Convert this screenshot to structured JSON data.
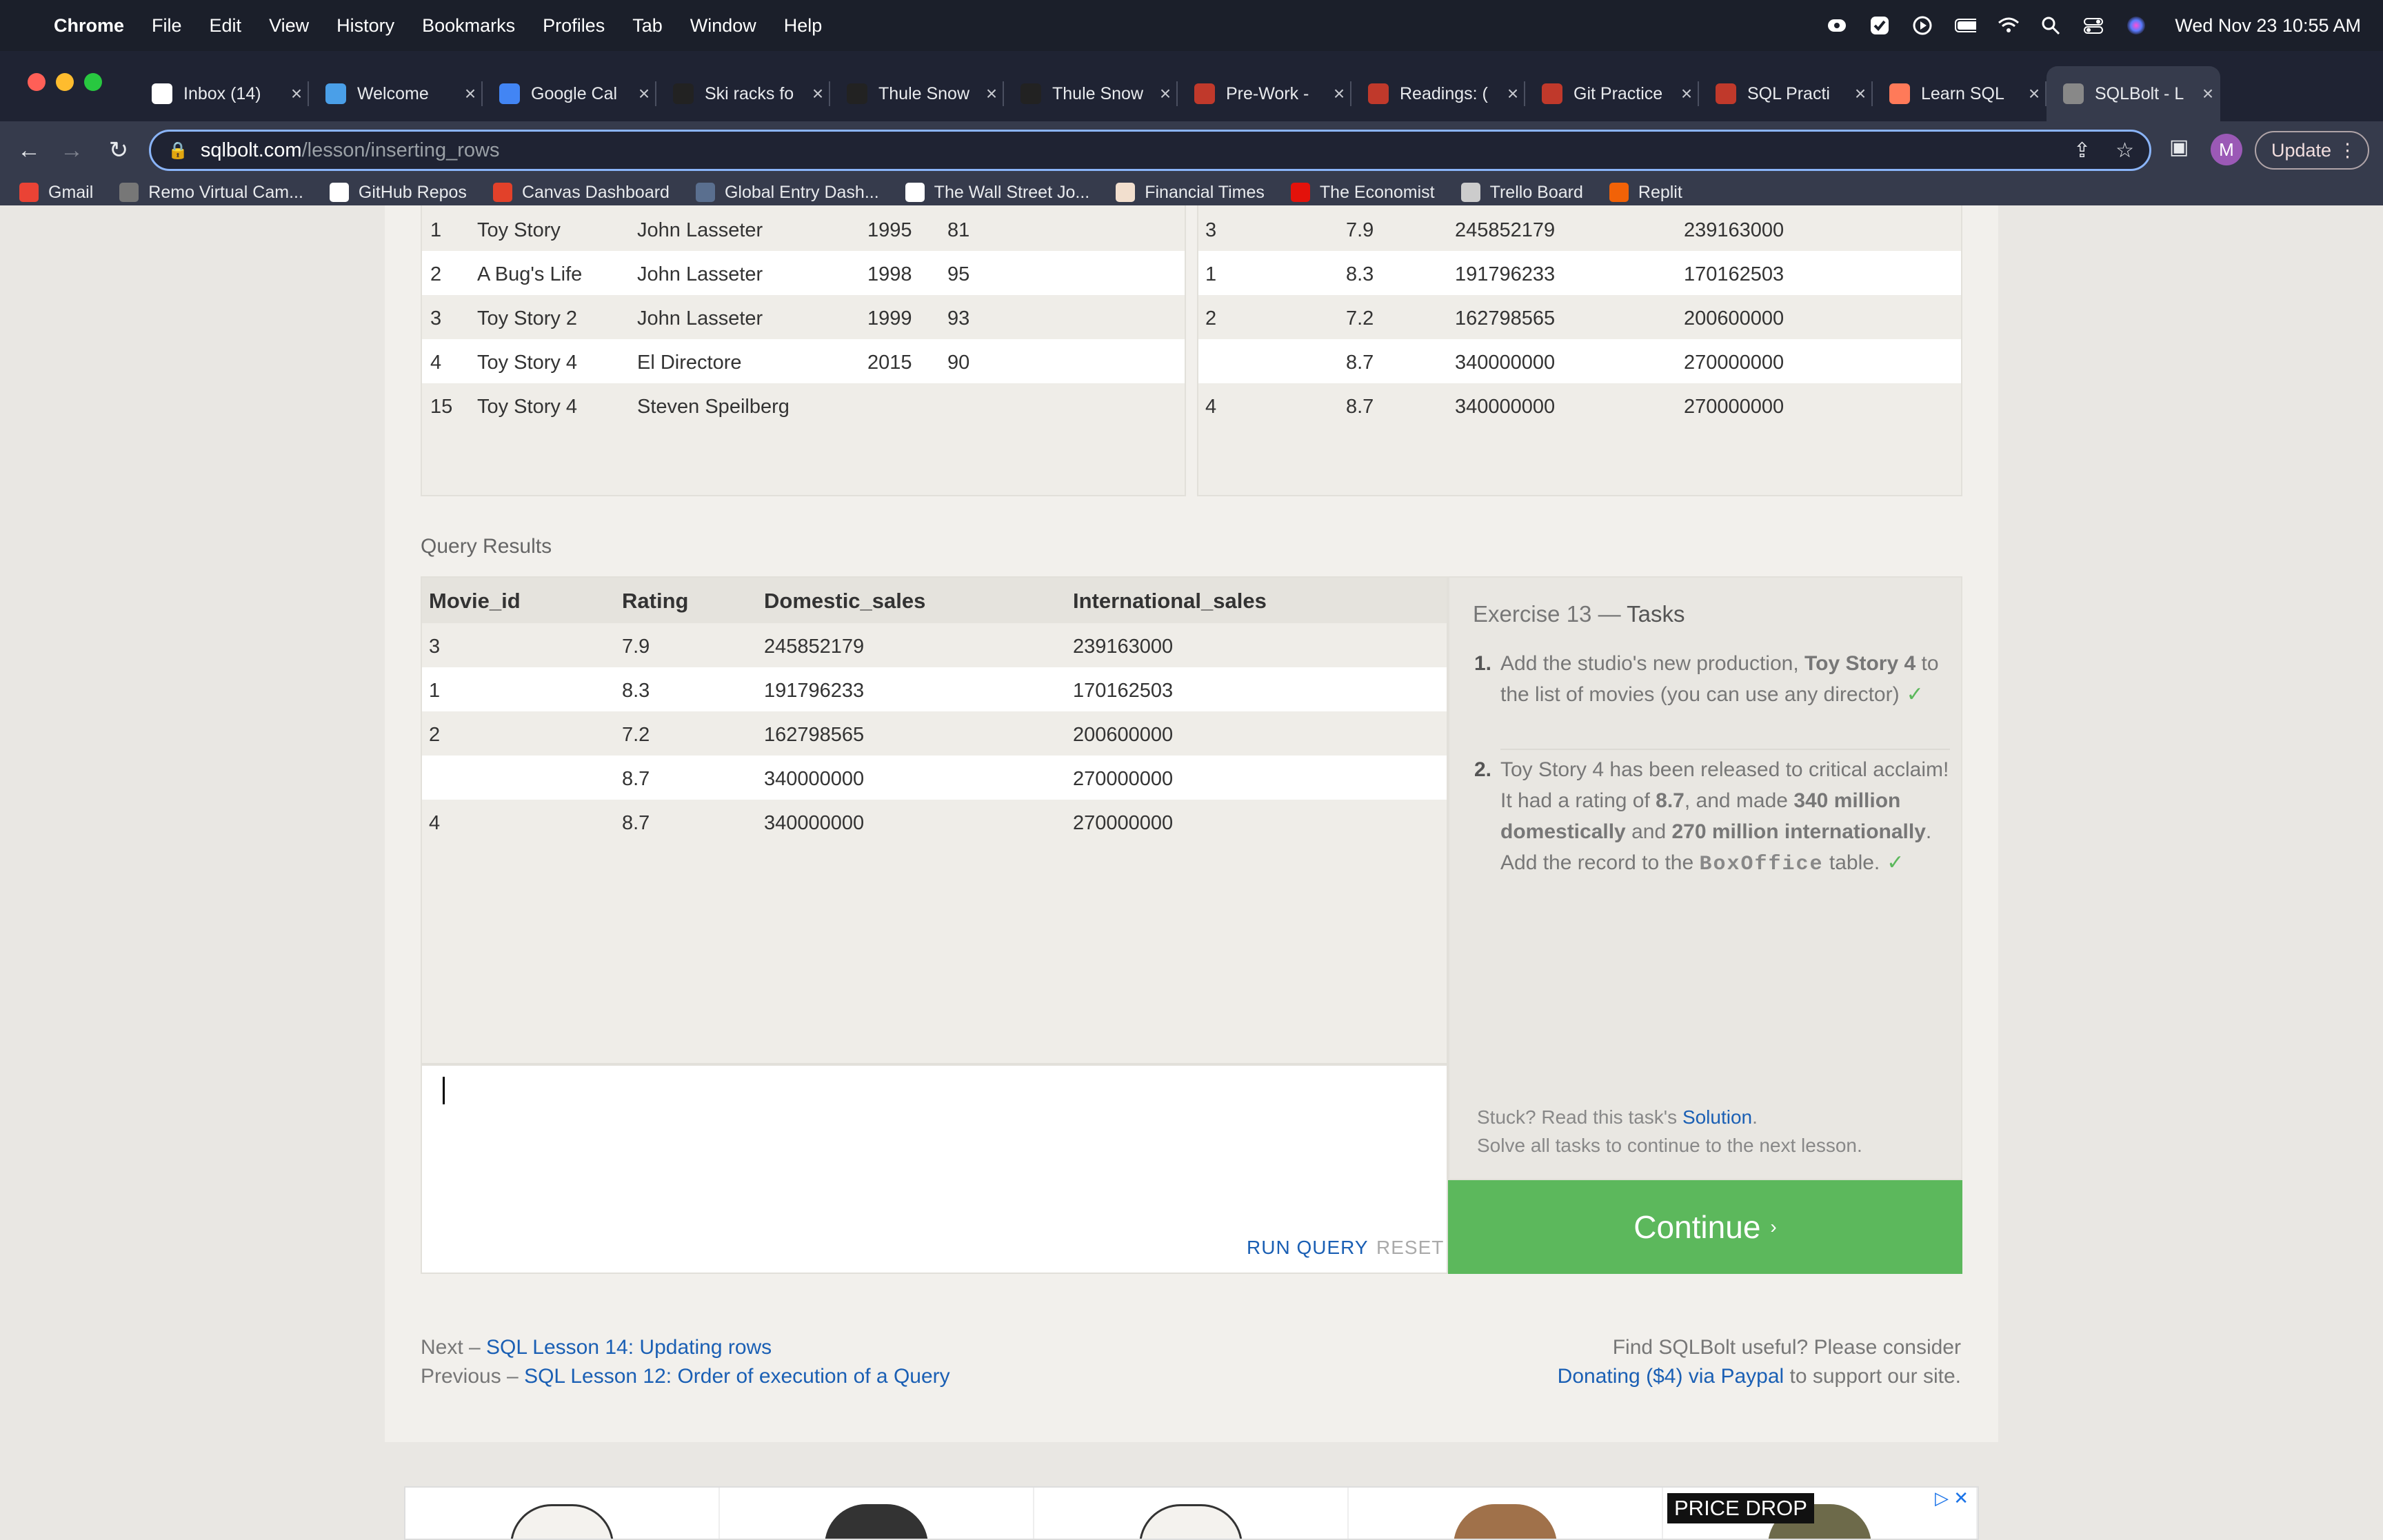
{
  "menubar": {
    "app_name": "Chrome",
    "menus": [
      "File",
      "Edit",
      "View",
      "History",
      "Bookmarks",
      "Profiles",
      "Tab",
      "Window",
      "Help"
    ],
    "datetime": "Wed Nov 23  10:55 AM"
  },
  "tabs": [
    {
      "title": "Inbox (14)",
      "icon": "gmail-icon",
      "color": "#ffffff"
    },
    {
      "title": "Welcome",
      "icon": "page-icon",
      "color": "#4a9fe8"
    },
    {
      "title": "Google Cal",
      "icon": "calendar-icon",
      "color": "#4285f4"
    },
    {
      "title": "Ski racks fo",
      "icon": "thule-icon",
      "color": "#222222"
    },
    {
      "title": "Thule Snow",
      "icon": "thule-icon",
      "color": "#222222"
    },
    {
      "title": "Thule Snow",
      "icon": "thule-icon",
      "color": "#222222"
    },
    {
      "title": "Pre-Work -",
      "icon": "shield-icon",
      "color": "#c0392b"
    },
    {
      "title": "Readings: (",
      "icon": "shield-icon",
      "color": "#c0392b"
    },
    {
      "title": "Git Practice",
      "icon": "shield-icon",
      "color": "#c0392b"
    },
    {
      "title": "SQL Practi",
      "icon": "shield-icon",
      "color": "#c0392b"
    },
    {
      "title": "Learn SQL",
      "icon": "hubspot-icon",
      "color": "#ff7a59"
    },
    {
      "title": "SQLBolt - L",
      "icon": "database-icon",
      "color": "#888888"
    }
  ],
  "url": {
    "host": "sqlbolt.com",
    "path": "/lesson/inserting_rows"
  },
  "update_label": "Update",
  "profile_initial": "M",
  "bookmarks": [
    {
      "label": "Gmail",
      "icon": "gmail-icon",
      "color": "#ea4335"
    },
    {
      "label": "Remo Virtual Cam...",
      "icon": "globe-icon",
      "color": "#777777"
    },
    {
      "label": "GitHub Repos",
      "icon": "github-icon",
      "color": "#ffffff"
    },
    {
      "label": "Canvas Dashboard",
      "icon": "canvas-icon",
      "color": "#e2412a"
    },
    {
      "label": "Global Entry Dash...",
      "icon": "seal-icon",
      "color": "#5a6f8f"
    },
    {
      "label": "The Wall Street Jo...",
      "icon": "wsj-icon",
      "color": "#ffffff"
    },
    {
      "label": "Financial Times",
      "icon": "ft-icon",
      "color": "#f2dfce"
    },
    {
      "label": "The Economist",
      "icon": "economist-icon",
      "color": "#e3120b"
    },
    {
      "label": "Trello Board",
      "icon": "trello-icon",
      "color": "#cccccc"
    },
    {
      "label": "Replit",
      "icon": "replit-icon",
      "color": "#f26207"
    }
  ],
  "movies_table": {
    "rows": [
      [
        "1",
        "Toy Story",
        "John Lasseter",
        "1995",
        "81"
      ],
      [
        "2",
        "A Bug's Life",
        "John Lasseter",
        "1998",
        "95"
      ],
      [
        "3",
        "Toy Story 2",
        "John Lasseter",
        "1999",
        "93"
      ],
      [
        "4",
        "Toy Story 4",
        "El Directore",
        "2015",
        "90"
      ],
      [
        "15",
        "Toy Story 4",
        "Steven Speilberg",
        "",
        ""
      ]
    ]
  },
  "boxoffice_table": {
    "rows": [
      [
        "3",
        "7.9",
        "245852179",
        "239163000"
      ],
      [
        "1",
        "8.3",
        "191796233",
        "170162503"
      ],
      [
        "2",
        "7.2",
        "162798565",
        "200600000"
      ],
      [
        "",
        "8.7",
        "340000000",
        "270000000"
      ],
      [
        "4",
        "8.7",
        "340000000",
        "270000000"
      ]
    ]
  },
  "query_results": {
    "label": "Query Results",
    "columns": [
      "Movie_id",
      "Rating",
      "Domestic_sales",
      "International_sales"
    ],
    "rows": [
      [
        "3",
        "7.9",
        "245852179",
        "239163000"
      ],
      [
        "1",
        "8.3",
        "191796233",
        "170162503"
      ],
      [
        "2",
        "7.2",
        "162798565",
        "200600000"
      ],
      [
        "",
        "8.7",
        "340000000",
        "270000000"
      ],
      [
        "4",
        "8.7",
        "340000000",
        "270000000"
      ]
    ]
  },
  "editor": {
    "run_label": "RUN QUERY",
    "reset_label": "RESET"
  },
  "tasks": {
    "title_prefix": "Exercise 13 — ",
    "title_bold": "Tasks",
    "task1": {
      "num": "1.",
      "a": "Add the studio's new production, ",
      "b": "Toy Story 4",
      "c": " to the list of movies (you can use any director)",
      "check": "✓"
    },
    "task2": {
      "num": "2.",
      "a": "Toy Story 4 has been released to critical acclaim! It had a rating of ",
      "b": "8.7",
      "c": ", and made ",
      "d": "340 million domestically",
      "e": " and ",
      "f": "270 million internationally",
      "g": ". Add the record to the ",
      "h": "BoxOffice",
      "i": " table.",
      "check": "✓"
    },
    "stuck_prefix": "Stuck? Read this task's ",
    "stuck_link": "Solution",
    "stuck_suffix": ".",
    "solve_all": "Solve all tasks to continue to the next lesson."
  },
  "continue": {
    "label": "Continue",
    "chevron": "›"
  },
  "footer": {
    "next_prefix": "Next – ",
    "next_link": "SQL Lesson 14: Updating rows",
    "prev_prefix": "Previous – ",
    "prev_link": "SQL Lesson 12: Order of execution of a Query",
    "useful": "Find SQLBolt useful? Please consider",
    "donate_link": "Donating ($4) via Paypal",
    "donate_suffix": " to support our site."
  },
  "ad": {
    "badge": "PRICE DROP"
  }
}
